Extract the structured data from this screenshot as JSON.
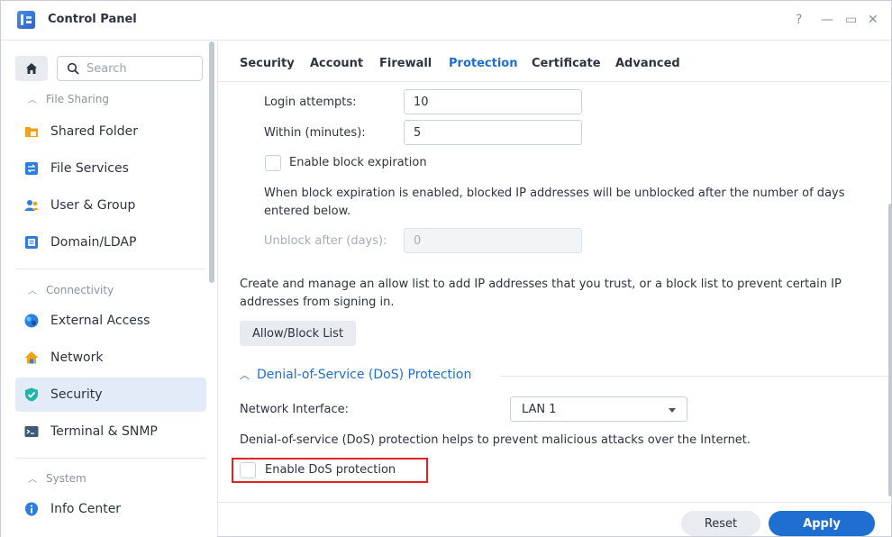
{
  "window": {
    "title": "Control Panel",
    "controls": {
      "help": "?",
      "minimize": "—",
      "maximize": "▭",
      "close": "✕"
    }
  },
  "sidebar": {
    "search_placeholder": "Search",
    "groups": [
      {
        "label": "File Sharing"
      },
      {
        "label": "Connectivity"
      },
      {
        "label": "System"
      }
    ],
    "items": [
      {
        "label": "Shared Folder",
        "icon": "shared-folder-icon"
      },
      {
        "label": "File Services",
        "icon": "file-services-icon"
      },
      {
        "label": "User & Group",
        "icon": "user-group-icon"
      },
      {
        "label": "Domain/LDAP",
        "icon": "domain-ldap-icon"
      },
      {
        "label": "External Access",
        "icon": "external-access-icon"
      },
      {
        "label": "Network",
        "icon": "network-icon"
      },
      {
        "label": "Security",
        "icon": "security-shield-icon",
        "active": true
      },
      {
        "label": "Terminal & SNMP",
        "icon": "terminal-icon"
      },
      {
        "label": "Info Center",
        "icon": "info-center-icon"
      }
    ]
  },
  "tabs": [
    {
      "label": "Security"
    },
    {
      "label": "Account"
    },
    {
      "label": "Firewall"
    },
    {
      "label": "Protection",
      "active": true
    },
    {
      "label": "Certificate"
    },
    {
      "label": "Advanced"
    }
  ],
  "block": {
    "login_attempts_label": "Login attempts:",
    "login_attempts_value": "10",
    "within_label": "Within (minutes):",
    "within_value": "5",
    "expiration_label": "Enable block expiration",
    "expiration_checked": false,
    "expiration_desc": "When block expiration is enabled, blocked IP addresses will be unblocked after the number of days entered below.",
    "unblock_label": "Unblock after (days):",
    "unblock_value": "0"
  },
  "allowlist": {
    "desc": "Create and manage an allow list to add IP addresses that you trust, or a block list to prevent certain IP addresses from signing in.",
    "button": "Allow/Block List"
  },
  "dos": {
    "section_title": "Denial-of-Service (DoS) Protection",
    "interface_label": "Network Interface:",
    "interface_value": "LAN 1",
    "desc": "Denial-of-service (DoS) protection helps to prevent malicious attacks over the Internet.",
    "enable_label": "Enable DoS protection",
    "enable_checked": false
  },
  "footer": {
    "reset": "Reset",
    "apply": "Apply"
  },
  "colors": {
    "accent": "#1f6fd1",
    "active_bg": "#e2ebf7",
    "highlight": "#e02424"
  }
}
